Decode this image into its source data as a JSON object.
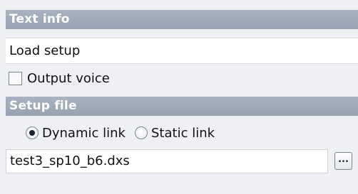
{
  "text_info": {
    "header": "Text info",
    "text_value": "Load setup",
    "output_voice": {
      "label": "Output voice",
      "checked": false
    }
  },
  "setup_file": {
    "header": "Setup file",
    "link_options": [
      {
        "label": "Dynamic link",
        "selected": true
      },
      {
        "label": "Static link",
        "selected": false
      }
    ],
    "file_value": "test3_sp10_b6.dxs",
    "browse_label": "..."
  }
}
